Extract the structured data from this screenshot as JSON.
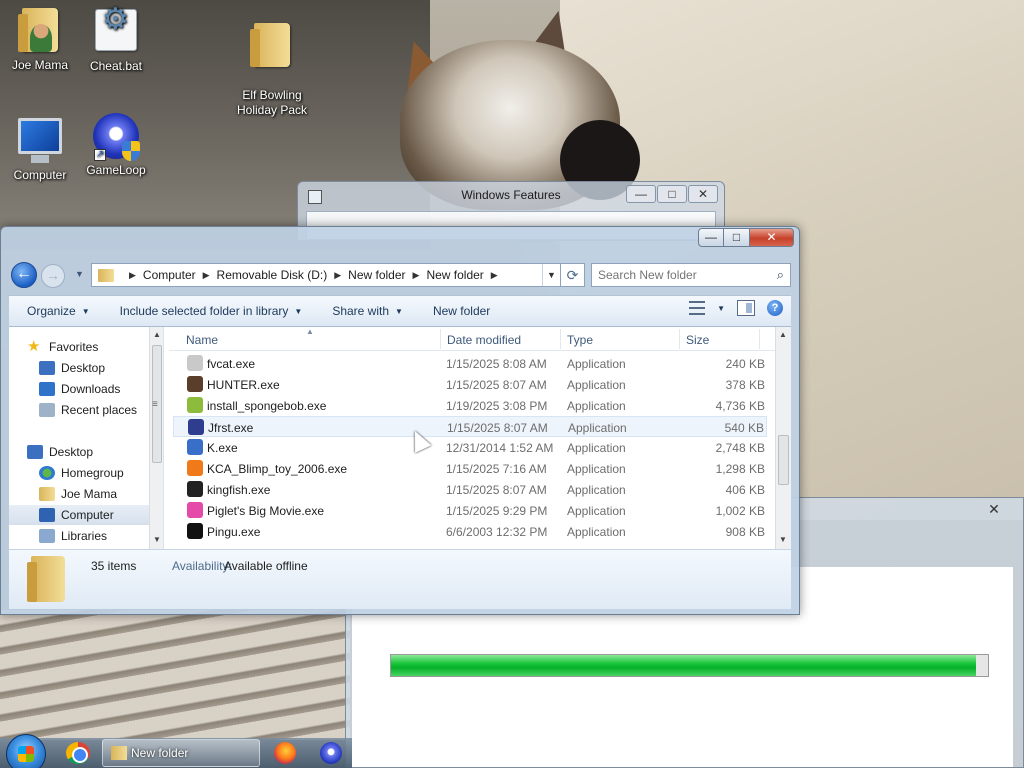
{
  "desktop": {
    "icons": [
      {
        "label": "Joe Mama"
      },
      {
        "label": "Cheat.bat"
      },
      {
        "label": "Elf Bowling\nHoliday Pack"
      },
      {
        "label": "Computer"
      },
      {
        "label": "GameLoop"
      }
    ]
  },
  "windows_features": {
    "title": "Windows Features"
  },
  "explorer": {
    "title_buttons": {
      "minimize": "—",
      "maximize": "□",
      "close": "✕"
    },
    "breadcrumbs": [
      "Computer",
      "Removable Disk (D:)",
      "New folder",
      "New folder"
    ],
    "search_placeholder": "Search New folder",
    "toolbar": {
      "organize": "Organize",
      "include_library": "Include selected folder in library",
      "share_with": "Share with",
      "new_folder": "New folder"
    },
    "nav": {
      "favorites": "Favorites",
      "desktop_fav": "Desktop",
      "downloads": "Downloads",
      "recent_places": "Recent places",
      "desktop": "Desktop",
      "homegroup": "Homegroup",
      "joe_mama": "Joe Mama",
      "computer": "Computer",
      "libraries": "Libraries"
    },
    "columns": {
      "name": "Name",
      "date": "Date modified",
      "type": "Type",
      "size": "Size"
    },
    "files": [
      {
        "name": "fvcat.exe",
        "date": "1/15/2025 8:08 AM",
        "type": "Application",
        "size": "240 KB",
        "color": "#c9c9c9"
      },
      {
        "name": "HUNTER.exe",
        "date": "1/15/2025 8:07 AM",
        "type": "Application",
        "size": "378 KB",
        "color": "#5a3e2b"
      },
      {
        "name": "install_spongebob.exe",
        "date": "1/19/2025 3:08 PM",
        "type": "Application",
        "size": "4,736 KB",
        "color": "#8dbb3c"
      },
      {
        "name": "Jfrst.exe",
        "date": "1/15/2025 8:07 AM",
        "type": "Application",
        "size": "540 KB",
        "color": "#2f3d8f"
      },
      {
        "name": "K.exe",
        "date": "12/31/2014 1:52 AM",
        "type": "Application",
        "size": "2,748 KB",
        "color": "#3a6fc9"
      },
      {
        "name": "KCA_Blimp_toy_2006.exe",
        "date": "1/15/2025 7:16 AM",
        "type": "Application",
        "size": "1,298 KB",
        "color": "#f07a1a"
      },
      {
        "name": "kingfish.exe",
        "date": "1/15/2025 8:07 AM",
        "type": "Application",
        "size": "406 KB",
        "color": "#222222"
      },
      {
        "name": "Piglet's Big Movie.exe",
        "date": "1/15/2025 9:29 PM",
        "type": "Application",
        "size": "1,002 KB",
        "color": "#e54aa8"
      },
      {
        "name": "Pingu.exe",
        "date": "6/6/2003 12:32 PM",
        "type": "Application",
        "size": "908 KB",
        "color": "#111111"
      }
    ],
    "details": {
      "count": "35 items",
      "availability_label": "Availability:",
      "availability_value": "Available offline"
    }
  },
  "progress_dialog": {
    "close": "✕",
    "progress": 0.98
  },
  "taskbar": {
    "folder_button": "New folder"
  }
}
